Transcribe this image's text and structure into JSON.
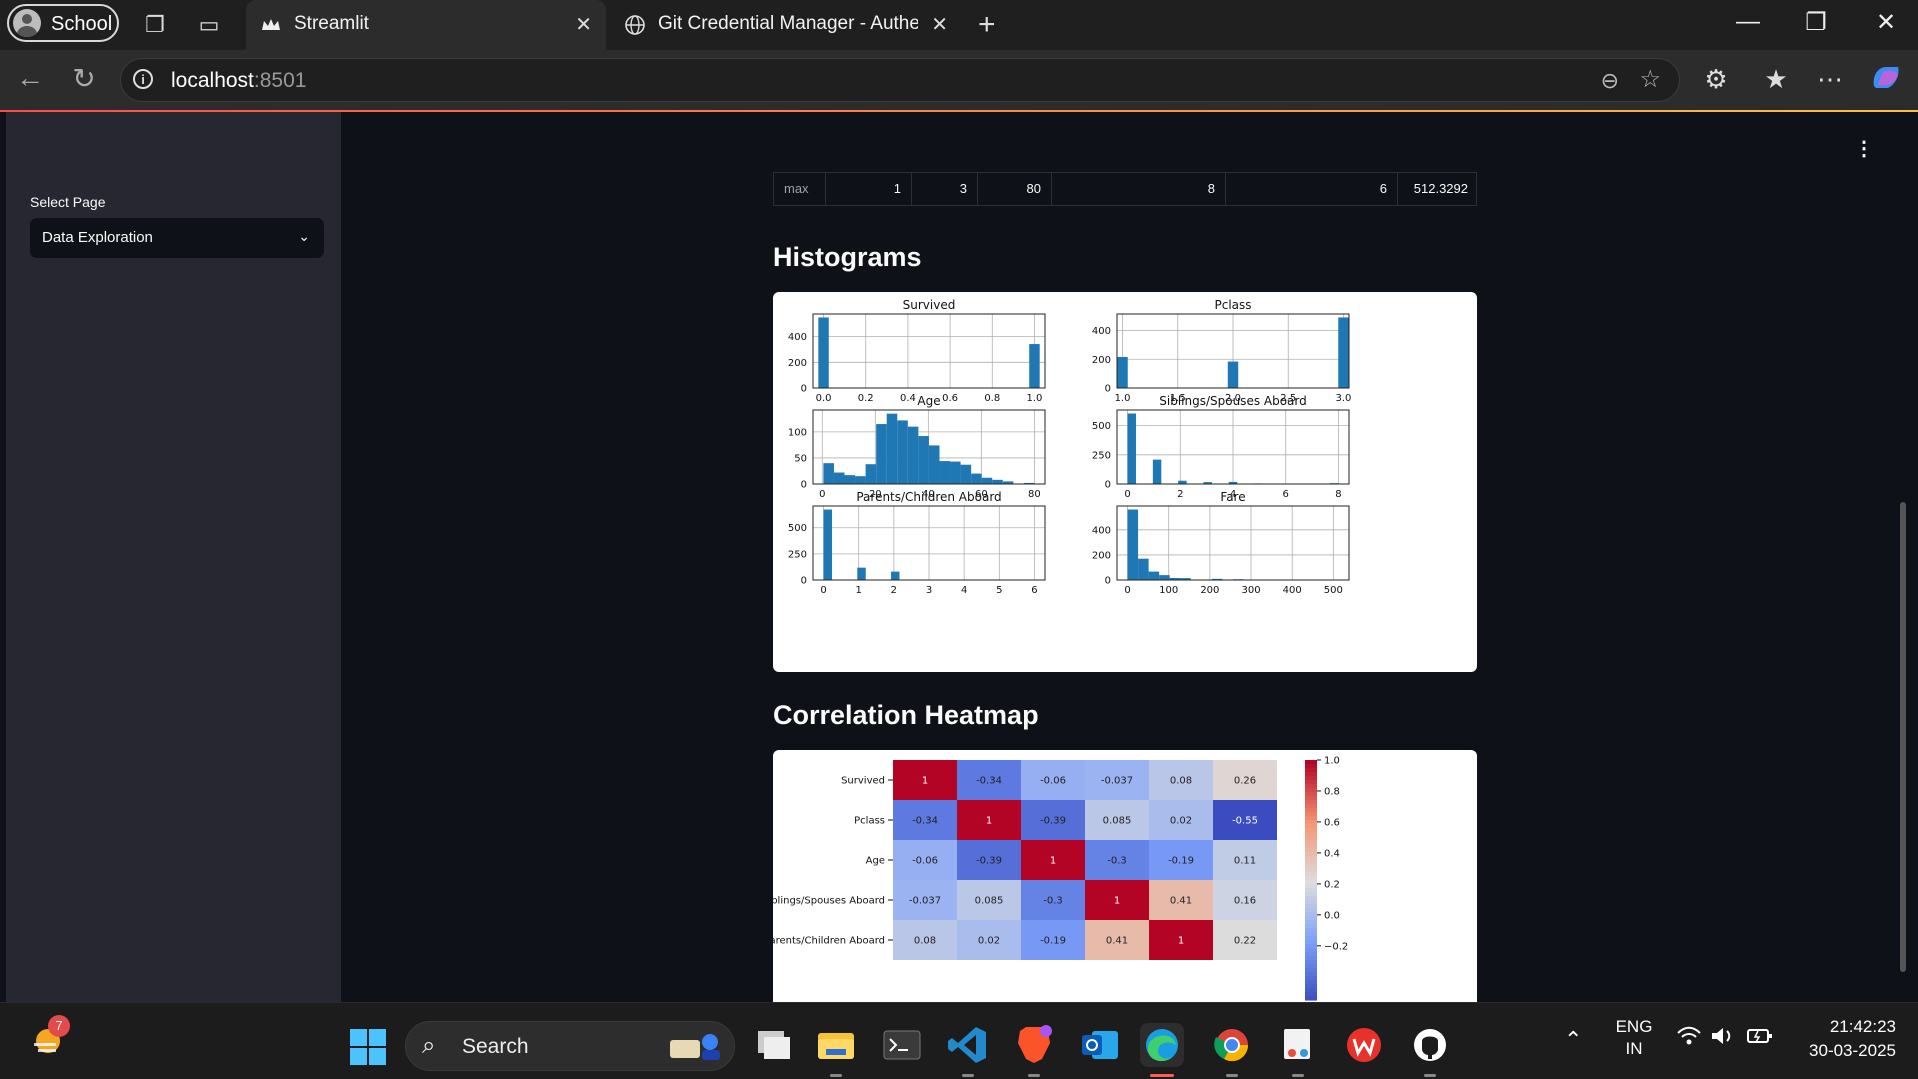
{
  "browser": {
    "profile_label": "School",
    "tabs": [
      {
        "title": "Streamlit",
        "active": true
      },
      {
        "title": "Git Credential Manager - Authent",
        "active": false
      }
    ],
    "url_host": "localhost",
    "url_port": ":8501"
  },
  "sidebar": {
    "select_label": "Select Page",
    "select_value": "Data Exploration"
  },
  "stats_table": {
    "row_label": "max",
    "values": [
      "1",
      "3",
      "80",
      "8",
      "6",
      "512.3292"
    ]
  },
  "sections": {
    "histograms_title": "Histograms",
    "heatmap_title": "Correlation Heatmap"
  },
  "chart_data": [
    {
      "type": "bar",
      "title": "Survived",
      "x_ticks": [
        "0.0",
        "0.2",
        "0.4",
        "0.6",
        "0.8",
        "1.0"
      ],
      "y_ticks": [
        "0",
        "200",
        "400"
      ],
      "bins": [
        [
          0.0,
          549
        ],
        [
          1.0,
          342
        ]
      ],
      "xlim": [
        -0.05,
        1.05
      ],
      "ylim": [
        0,
        576
      ]
    },
    {
      "type": "bar",
      "title": "Pclass",
      "x_ticks": [
        "1.0",
        "1.5",
        "2.0",
        "2.5",
        "3.0"
      ],
      "y_ticks": [
        "0",
        "200",
        "400"
      ],
      "bins": [
        [
          1.0,
          216
        ],
        [
          2.0,
          184
        ],
        [
          3.0,
          491
        ]
      ],
      "xlim": [
        0.95,
        3.05
      ],
      "ylim": [
        0,
        515
      ]
    },
    {
      "type": "bar",
      "title": "Age",
      "x_ticks": [
        "0",
        "20",
        "40",
        "60",
        "80"
      ],
      "y_ticks": [
        "0",
        "50",
        "100"
      ],
      "bin_width": 3.98,
      "bin_starts": [
        0.42,
        4.4,
        8.38,
        12.36,
        16.34,
        20.32,
        24.3,
        28.28,
        32.26,
        36.24,
        40.22,
        44.2,
        48.18,
        52.16,
        56.14,
        60.12,
        64.1,
        68.08,
        72.06,
        76.04
      ],
      "values": [
        40,
        22,
        17,
        15,
        38,
        115,
        135,
        122,
        110,
        92,
        74,
        44,
        43,
        37,
        20,
        12,
        8,
        5,
        1,
        2
      ],
      "xlim": [
        -3.5,
        84
      ],
      "ylim": [
        0,
        142
      ]
    },
    {
      "type": "bar",
      "title": "Siblings/Spouses Aboard",
      "x_ticks": [
        "0",
        "2",
        "4",
        "6",
        "8"
      ],
      "y_ticks": [
        "0",
        "250",
        "500"
      ],
      "bin_width": 0.32,
      "bin_starts": [
        0,
        0.96,
        1.92,
        2.88,
        3.84,
        4.8,
        7.68
      ],
      "values": [
        604,
        209,
        28,
        16,
        18,
        5,
        7
      ],
      "xlim": [
        -0.4,
        8.4
      ],
      "ylim": [
        0,
        634
      ]
    },
    {
      "type": "bar",
      "title": "Parents/Children Aboard",
      "x_ticks": [
        "0",
        "1",
        "2",
        "3",
        "4",
        "5",
        "6"
      ],
      "y_ticks": [
        "0",
        "250",
        "500"
      ],
      "bin_width": 0.24,
      "bin_starts": [
        0,
        0.96,
        1.92,
        2.88,
        3.84,
        4.8,
        5.76
      ],
      "values": [
        674,
        118,
        80,
        5,
        4,
        5,
        1
      ],
      "xlim": [
        -0.3,
        6.3
      ],
      "ylim": [
        0,
        708
      ]
    },
    {
      "type": "bar",
      "title": "Fare",
      "x_ticks": [
        "0",
        "100",
        "200",
        "300",
        "400",
        "500"
      ],
      "y_ticks": [
        "0",
        "200",
        "400"
      ],
      "bin_width": 25.6,
      "bin_starts": [
        0,
        25.6,
        51.2,
        76.8,
        102.4,
        128,
        153.6,
        179.2,
        204.8,
        230.4,
        256,
        281.6,
        307.2,
        486.4
      ],
      "values": [
        562,
        170,
        67,
        39,
        16,
        15,
        2,
        0,
        9,
        2,
        6,
        0,
        0,
        3
      ],
      "xlim": [
        -25.6,
        538
      ],
      "ylim": [
        0,
        590
      ]
    },
    {
      "type": "heatmap",
      "row_labels": [
        "Survived",
        "Pclass",
        "Age",
        "Siblings/Spouses Aboard",
        "Parents/Children Aboard"
      ],
      "values": [
        [
          1,
          -0.34,
          -0.06,
          -0.037,
          0.08,
          0.26
        ],
        [
          -0.34,
          1,
          -0.39,
          0.085,
          0.02,
          -0.55
        ],
        [
          -0.06,
          -0.39,
          1,
          -0.3,
          -0.19,
          0.11
        ],
        [
          -0.037,
          0.085,
          -0.3,
          1,
          0.41,
          0.16
        ],
        [
          0.08,
          0.02,
          -0.19,
          0.41,
          1,
          0.22
        ]
      ],
      "value_labels": [
        [
          "1",
          "-0.34",
          "-0.06",
          "-0.037",
          "0.08",
          "0.26"
        ],
        [
          "-0.34",
          "1",
          "-0.39",
          "0.085",
          "0.02",
          "-0.55"
        ],
        [
          "-0.06",
          "-0.39",
          "1",
          "-0.3",
          "-0.19",
          "0.11"
        ],
        [
          "-0.037",
          "0.085",
          "-0.3",
          "1",
          "0.41",
          "0.16"
        ],
        [
          "0.08",
          "0.02",
          "-0.19",
          "0.41",
          "1",
          "0.22"
        ]
      ],
      "colorbar_ticks": [
        "1.0",
        "0.8",
        "0.6",
        "0.4",
        "0.2",
        "0.0",
        "−0.2"
      ],
      "colorbar_values": [
        1.0,
        0.8,
        0.6,
        0.4,
        0.2,
        0.0,
        -0.2
      ],
      "vmin": -0.55,
      "vmax": 1.0,
      "colormap": "coolwarm"
    }
  ],
  "taskbar": {
    "widgets_badge": "7",
    "search_label": "Search",
    "apps": [
      "task-view",
      "file-explorer",
      "terminal",
      "vs-code",
      "brave",
      "outlook",
      "edge",
      "chrome",
      "snipping-tool",
      "wps-office",
      "github-desktop"
    ],
    "lang_primary": "ENG",
    "lang_secondary": "IN",
    "time": "21:42:23",
    "date": "30-03-2025"
  },
  "colors": {
    "bar_blue": "#1f77b4",
    "streamlit_bg": "#0e1117",
    "sidebar_bg": "#262730"
  }
}
